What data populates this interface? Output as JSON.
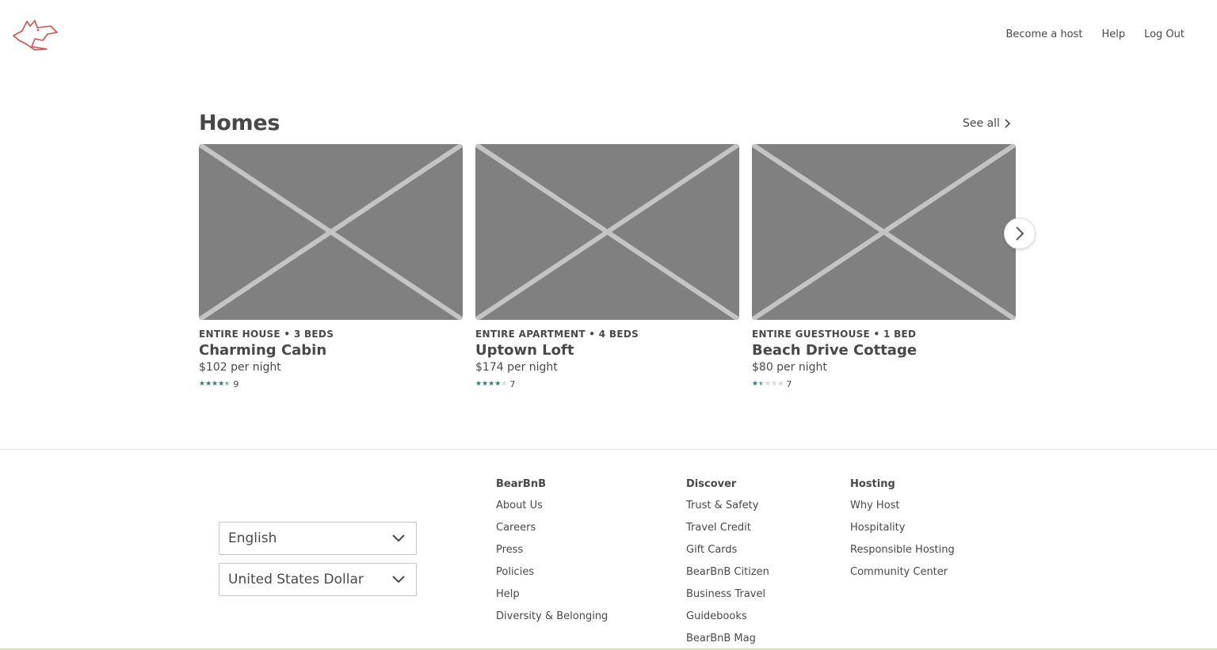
{
  "nav": {
    "become_host": "Become a host",
    "help": "Help",
    "logout": "Log Out"
  },
  "section": {
    "title": "Homes",
    "see_all": "See all"
  },
  "listings": [
    {
      "type": "ENTIRE HOUSE • 3 BEDS",
      "name": "Charming Cabin",
      "price": "$102 per night",
      "rating": 4.5,
      "reviews": "9"
    },
    {
      "type": "ENTIRE APARTMENT • 4 BEDS",
      "name": "Uptown Loft",
      "price": "$174 per night",
      "rating": 4,
      "reviews": "7"
    },
    {
      "type": "ENTIRE GUESTHOUSE • 1 BED",
      "name": "Beach Drive Cottage",
      "price": "$80 per night",
      "rating": 1.5,
      "reviews": "7"
    }
  ],
  "footer": {
    "language": "English",
    "currency": "United States Dollar",
    "columns": [
      {
        "title": "BearBnB",
        "links": [
          "About Us",
          "Careers",
          "Press",
          "Policies",
          "Help",
          "Diversity & Belonging"
        ]
      },
      {
        "title": "Discover",
        "links": [
          "Trust & Safety",
          "Travel Credit",
          "Gift Cards",
          "BearBnB Citizen",
          "Business Travel",
          "Guidebooks",
          "BearBnB Mag"
        ]
      },
      {
        "title": "Hosting",
        "links": [
          "Why Host",
          "Hospitality",
          "Responsible Hosting",
          "Community Center"
        ]
      }
    ]
  },
  "colors": {
    "brand": "#e04a4a",
    "star": "#2e7d7d",
    "placeholder": "#808080"
  }
}
